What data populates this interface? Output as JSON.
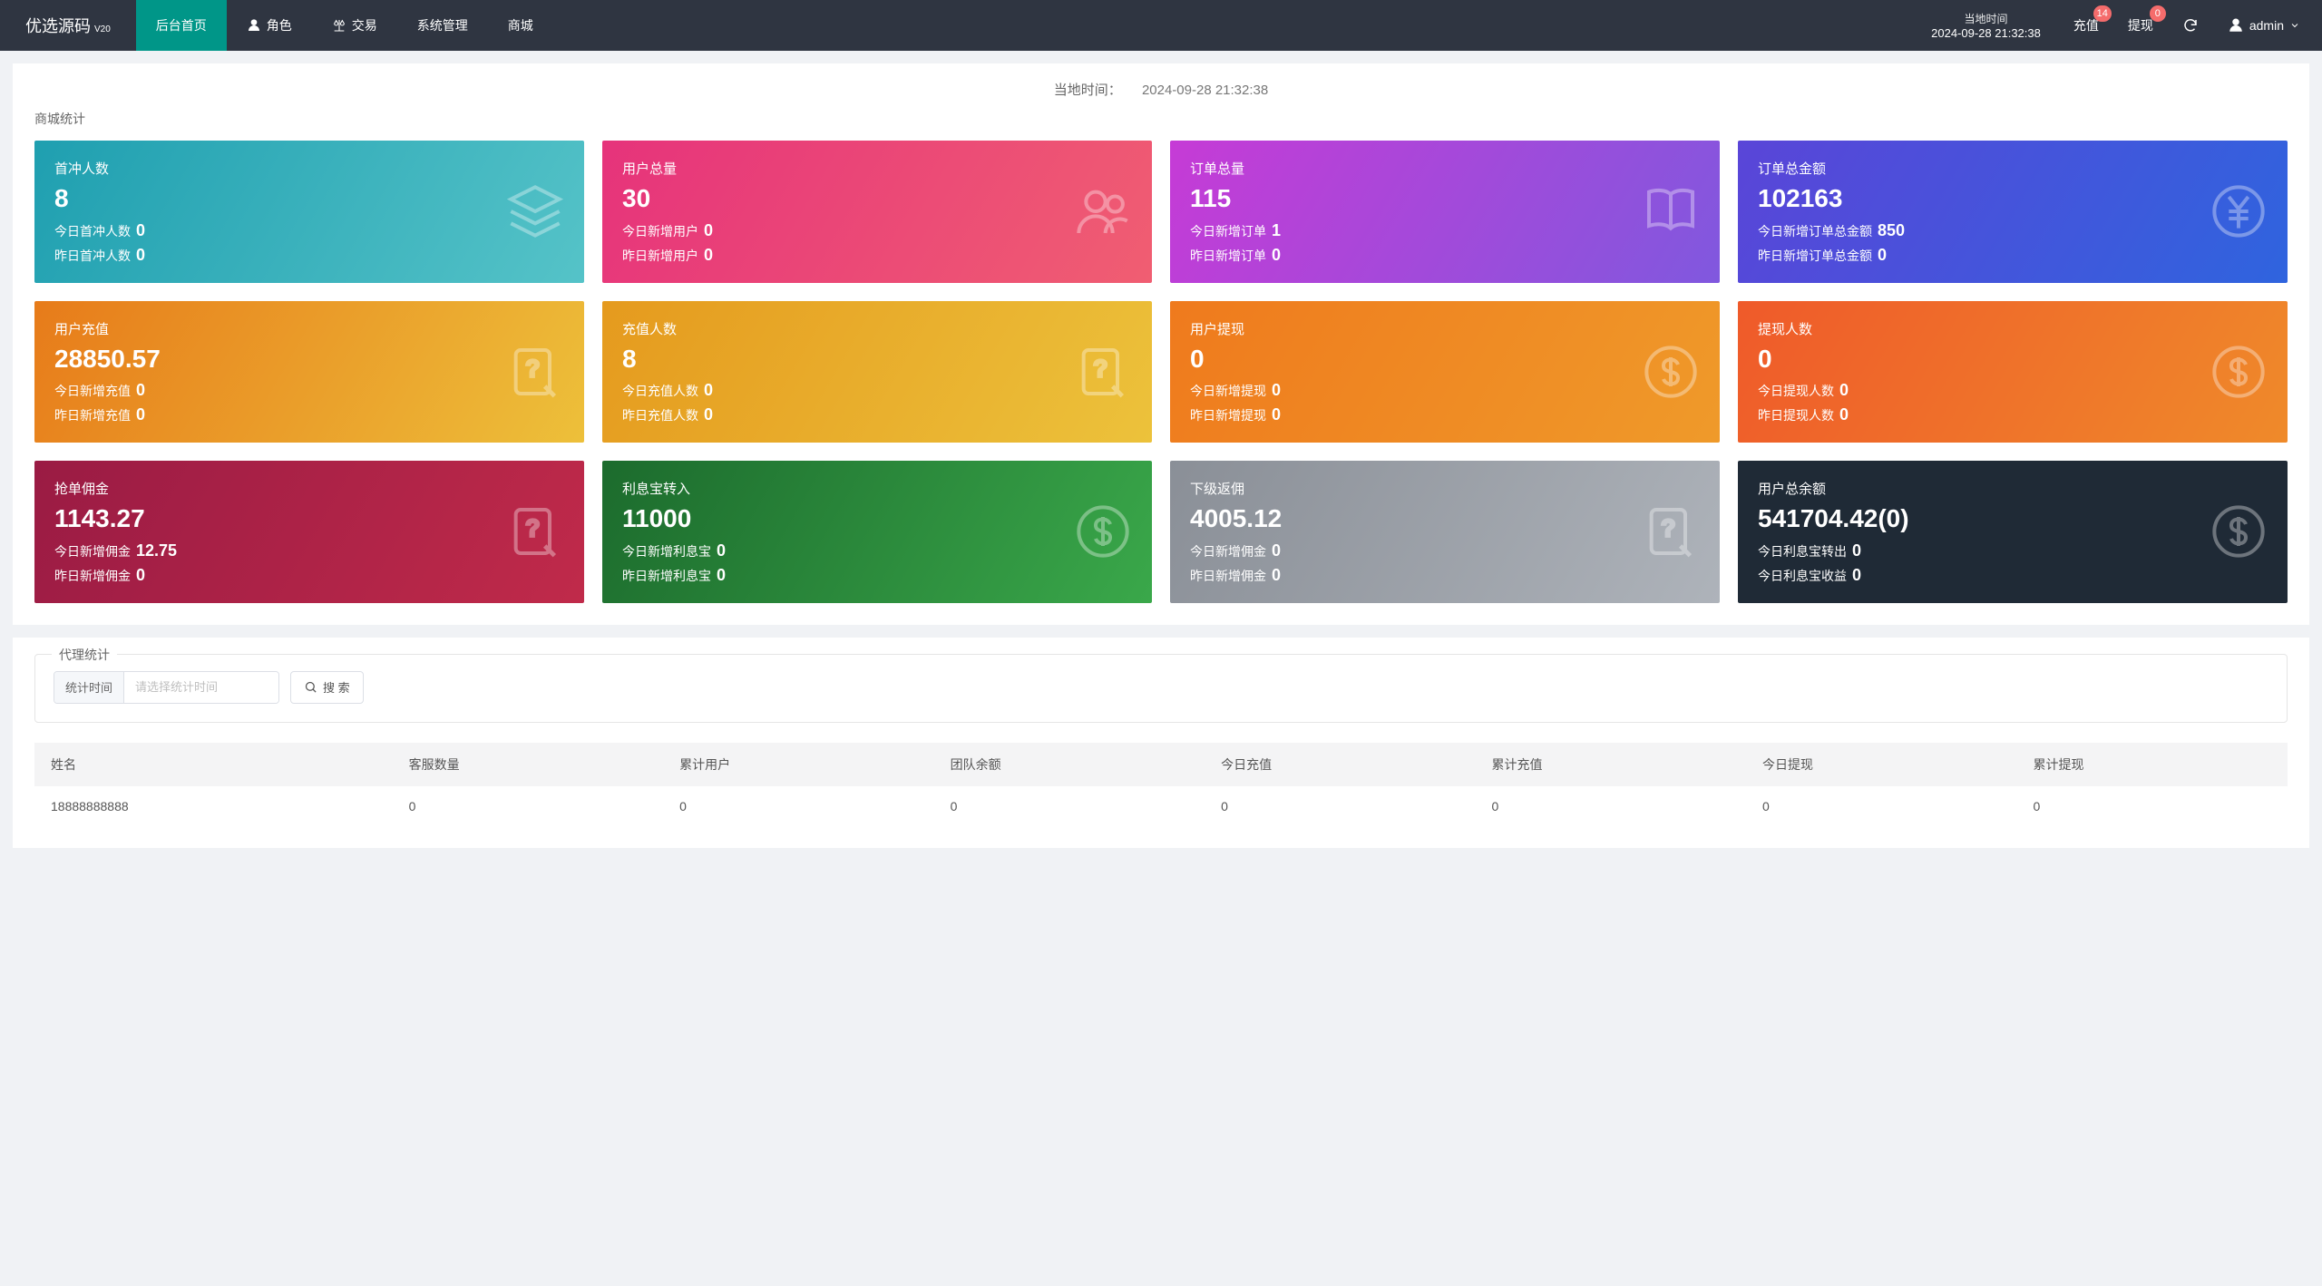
{
  "brand": {
    "name": "优选源码",
    "version": "V20"
  },
  "nav": {
    "home": "后台首页",
    "role": "角色",
    "trade": "交易",
    "system": "系统管理",
    "mall": "商城"
  },
  "topbar": {
    "local_time_label": "当地时间",
    "local_time_value": "2024-09-28 21:32:38",
    "recharge": "充值",
    "recharge_badge": "14",
    "withdraw": "提现",
    "withdraw_badge": "0",
    "user": "admin"
  },
  "centerTime": {
    "label": "当地时间：",
    "value": "2024-09-28 21:32:38"
  },
  "sectionMallTitle": "商城统计",
  "cards": [
    {
      "title": "首冲人数",
      "big": "8",
      "todayLabel": "今日首冲人数",
      "today": "0",
      "yestLabel": "昨日首冲人数",
      "yest": "0"
    },
    {
      "title": "用户总量",
      "big": "30",
      "todayLabel": "今日新增用户",
      "today": "0",
      "yestLabel": "昨日新增用户",
      "yest": "0"
    },
    {
      "title": "订单总量",
      "big": "115",
      "todayLabel": "今日新增订单",
      "today": "1",
      "yestLabel": "昨日新增订单",
      "yest": "0"
    },
    {
      "title": "订单总金额",
      "big": "102163",
      "todayLabel": "今日新增订单总金额",
      "today": "850",
      "yestLabel": "昨日新增订单总金额",
      "yest": "0"
    },
    {
      "title": "用户充值",
      "big": "28850.57",
      "todayLabel": "今日新增充值",
      "today": "0",
      "yestLabel": "昨日新增充值",
      "yest": "0"
    },
    {
      "title": "充值人数",
      "big": "8",
      "todayLabel": "今日充值人数",
      "today": "0",
      "yestLabel": "昨日充值人数",
      "yest": "0"
    },
    {
      "title": "用户提现",
      "big": "0",
      "todayLabel": "今日新增提现",
      "today": "0",
      "yestLabel": "昨日新增提现",
      "yest": "0"
    },
    {
      "title": "提现人数",
      "big": "0",
      "todayLabel": "今日提现人数",
      "today": "0",
      "yestLabel": "昨日提现人数",
      "yest": "0"
    },
    {
      "title": "抢单佣金",
      "big": "1143.27",
      "todayLabel": "今日新增佣金",
      "today": "12.75",
      "yestLabel": "昨日新增佣金",
      "yest": "0"
    },
    {
      "title": "利息宝转入",
      "big": "11000",
      "todayLabel": "今日新增利息宝",
      "today": "0",
      "yestLabel": "昨日新增利息宝",
      "yest": "0"
    },
    {
      "title": "下级返佣",
      "big": "4005.12",
      "todayLabel": "今日新增佣金",
      "today": "0",
      "yestLabel": "昨日新增佣金",
      "yest": "0"
    },
    {
      "title": "用户总余额",
      "big": "541704.42(0)",
      "todayLabel": "今日利息宝转出",
      "today": "0",
      "yestLabel": "今日利息宝收益",
      "yest": "0"
    }
  ],
  "agent": {
    "legend": "代理统计",
    "timeLabel": "统计时间",
    "timePlaceholder": "请选择统计时间",
    "searchBtn": "搜 索",
    "columns": {
      "name": "姓名",
      "cs": "客服数量",
      "users": "累计用户",
      "balance": "团队余额",
      "todayRecharge": "今日充值",
      "totalRecharge": "累计充值",
      "todayWithdraw": "今日提现",
      "totalWithdraw": "累计提现"
    },
    "row": {
      "name": "18888888888",
      "cs": "0",
      "users": "0",
      "balance": "0",
      "todayRecharge": "0",
      "totalRecharge": "0",
      "todayWithdraw": "0",
      "totalWithdraw": "0"
    }
  }
}
